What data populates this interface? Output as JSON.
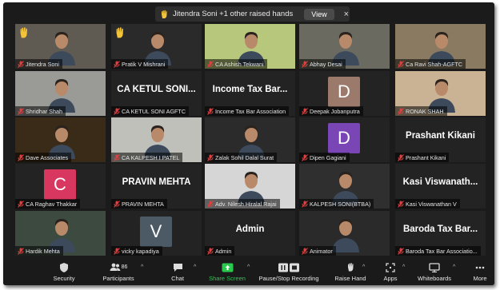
{
  "notification": {
    "text": "Jitendra Soni +1 other raised hands",
    "view_label": "View",
    "close_glyph": "×"
  },
  "tiles": [
    {
      "name": "Jitendra Soni",
      "kind": "video",
      "hand": true,
      "bg": "#5f5a52"
    },
    {
      "name": "Pratik V Mishrani",
      "kind": "video",
      "hand": true,
      "bg": "#2a2a2a"
    },
    {
      "name": "CA Ashish Tekwani",
      "kind": "video",
      "hand": false,
      "bg": "#b7c87c"
    },
    {
      "name": "Abhay Desai",
      "kind": "video",
      "hand": false,
      "bg": "#6b6a60",
      "active": true
    },
    {
      "name": "Ca Ravi Shah-AGFTC",
      "kind": "video",
      "hand": false,
      "bg": "#8a7a62"
    },
    {
      "name": "Shridhar Shah",
      "kind": "video",
      "hand": false,
      "bg": "#9a9a96"
    },
    {
      "name": "CA KETUL SONI AGFTC",
      "kind": "text",
      "display": "CA KETUL SONI..."
    },
    {
      "name": "Income Tax Bar Association",
      "kind": "text",
      "display": "Income Tax Bar..."
    },
    {
      "name": "Deepak Jobanputra",
      "kind": "letter",
      "letter": "D",
      "letter_color": "#9b7a6c"
    },
    {
      "name": "RONAK SHAH",
      "kind": "video",
      "hand": false,
      "bg": "#c9b394"
    },
    {
      "name": "Dave Associates",
      "kind": "video",
      "hand": false,
      "bg": "#3a2a18"
    },
    {
      "name": "CA KALPESH I PATEL",
      "kind": "video",
      "hand": false,
      "bg": "#c0c0bb"
    },
    {
      "name": "Zalak Sohil Dalal Surat",
      "kind": "video",
      "hand": false,
      "bg": "#2b2b2b"
    },
    {
      "name": "Dipen Gagiani",
      "kind": "letter",
      "letter": "D",
      "letter_color": "#7a45b5"
    },
    {
      "name": "Prashant Kikani",
      "kind": "text",
      "display": "Prashant Kikani"
    },
    {
      "name": "CA Raghav Thakkar",
      "kind": "letter",
      "letter": "C",
      "letter_color": "#d8375f"
    },
    {
      "name": "PRAVIN MEHTA",
      "kind": "text",
      "display": "PRAVIN MEHTA"
    },
    {
      "name": "Adv. Nilesh Hiralal Rajai",
      "kind": "video",
      "hand": false,
      "bg": "#d6d6d6"
    },
    {
      "name": "KALPESH SONI(BTBA)",
      "kind": "video",
      "hand": false,
      "bg": "#2f2f2f"
    },
    {
      "name": "Kasi Viswanathan V",
      "kind": "text",
      "display": "Kasi Viswanath..."
    },
    {
      "name": "Hardik Mehta",
      "kind": "video",
      "hand": false,
      "bg": "#3c4a3f"
    },
    {
      "name": "vicky kapadiya",
      "kind": "letter",
      "letter": "V",
      "letter_color": "#4c5a66"
    },
    {
      "name": "Admin",
      "kind": "text",
      "display": "Admin"
    },
    {
      "name": "Animator",
      "kind": "video",
      "hand": false,
      "bg": "#2a2a2a"
    },
    {
      "name": "Baroda Tax Bar Association",
      "kind": "text",
      "display": "Baroda Tax Bar..."
    }
  ],
  "tile_labels": [
    "Jitendra Soni",
    "Pratik V Mishrani",
    "CA Ashish Tekwani",
    "Abhay Desai",
    "Ca Ravi Shah-AGFTC",
    "Shridhar Shah",
    "CA KETUL SONI AGFTC",
    "Income Tax Bar Association",
    "Deepak Jobanputra",
    "RONAK SHAH",
    "Dave Associates",
    "CA KALPESH I PATEL",
    "Zalak Sohil Dalal Surat",
    "Dipen Gagiani",
    "Prashant Kikani",
    "CA Raghav Thakkar",
    "PRAVIN MEHTA",
    "Adv. Nilesh Hiralal Rajai",
    "KALPESH SONI(BTBA)",
    "Kasi Viswanathan V",
    "Hardik Mehta",
    "vicky kapadiya",
    "Admin",
    "Animator",
    "Baroda Tax Bar Associatio..."
  ],
  "toolbar": {
    "security": "Security",
    "participants": "Participants",
    "participants_count": "86",
    "chat": "Chat",
    "share_screen": "Share Screen",
    "record": "Pause/Stop Recording",
    "raise_hand": "Raise Hand",
    "apps": "Apps",
    "whiteboards": "Whiteboards",
    "more": "More",
    "accent_color": "#2ac94e"
  }
}
